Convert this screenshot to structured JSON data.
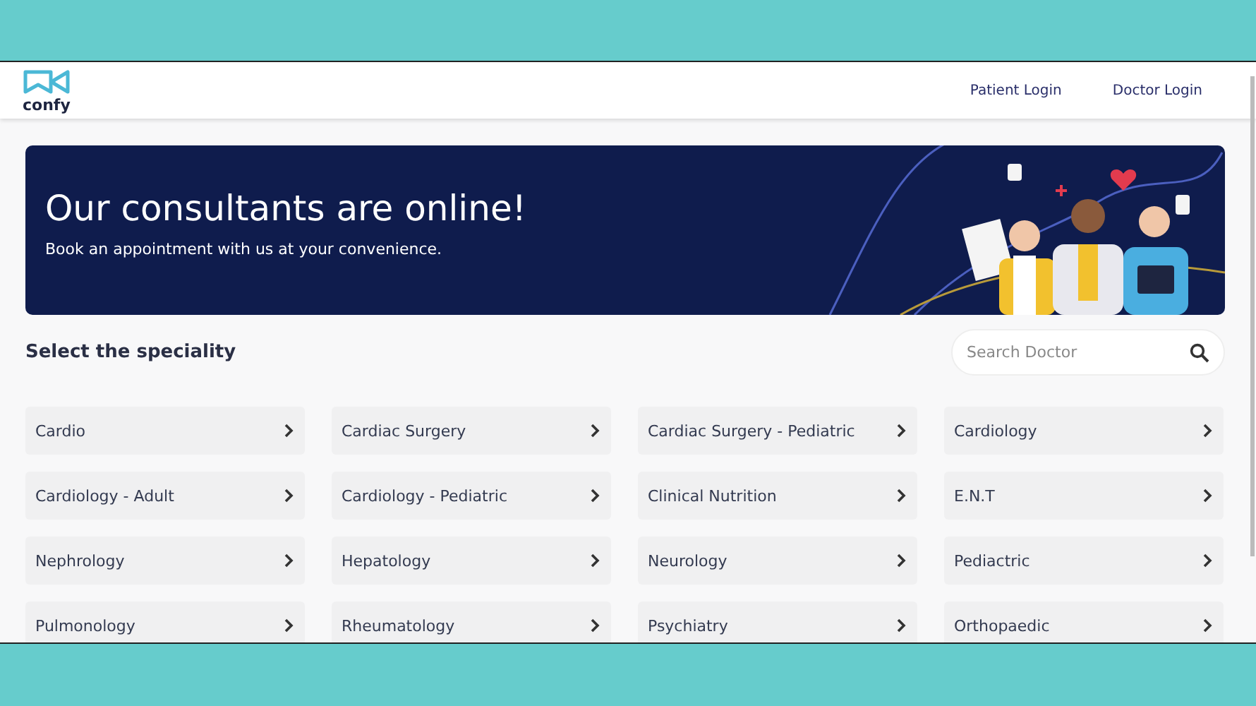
{
  "header": {
    "logo": "confy",
    "links": [
      "Patient Login",
      "Doctor Login"
    ]
  },
  "banner": {
    "title": "Our consultants are online!",
    "subtitle": "Book an appointment with us at your convenience."
  },
  "section": {
    "title": "Select the speciality"
  },
  "search": {
    "placeholder": "Search Doctor"
  },
  "specialities": [
    "Cardio",
    "Cardiac Surgery",
    "Cardiac Surgery - Pediatric",
    "Cardiology",
    "Cardiology - Adult",
    "Cardiology - Pediatric",
    "Clinical Nutrition",
    "E.N.T",
    "Nephrology",
    "Hepatology",
    "Neurology",
    "Pediactric",
    "Pulmonology",
    "Rheumatology",
    "Psychiatry",
    "Orthopaedic"
  ]
}
